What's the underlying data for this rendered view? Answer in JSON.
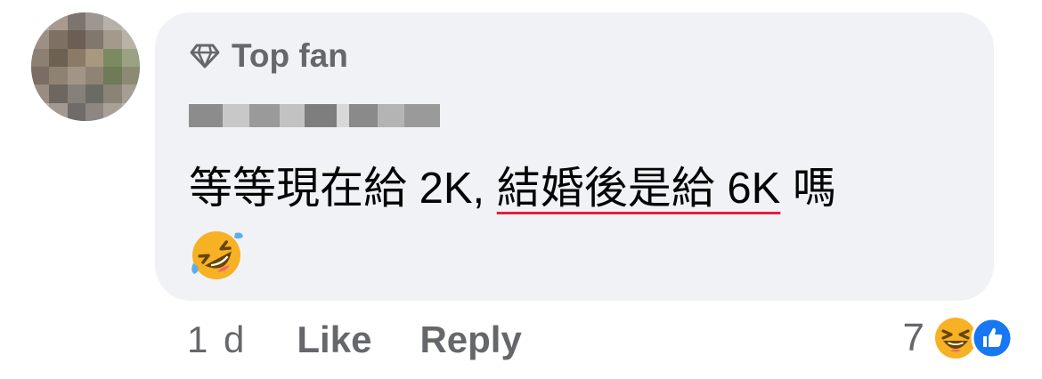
{
  "comment": {
    "badge": "Top fan",
    "author_name_blurred": "Name hidden",
    "text_plain": "等等現在給 2K, ",
    "text_underlined": "結婚後是給 6K",
    "text_suffix": " 嗎",
    "emoji": "rolling-on-floor-laughing"
  },
  "footer": {
    "timestamp": "1 d",
    "like_label": "Like",
    "reply_label": "Reply"
  },
  "reactions": {
    "count": "7",
    "types": [
      "haha",
      "like"
    ]
  },
  "colors": {
    "bubble": "#f0f2f5",
    "text": "#050505",
    "secondary": "#65676b",
    "underline": "#e41e3f",
    "like_blue": "#1877f2",
    "emoji_yellow": "#f7b125"
  }
}
